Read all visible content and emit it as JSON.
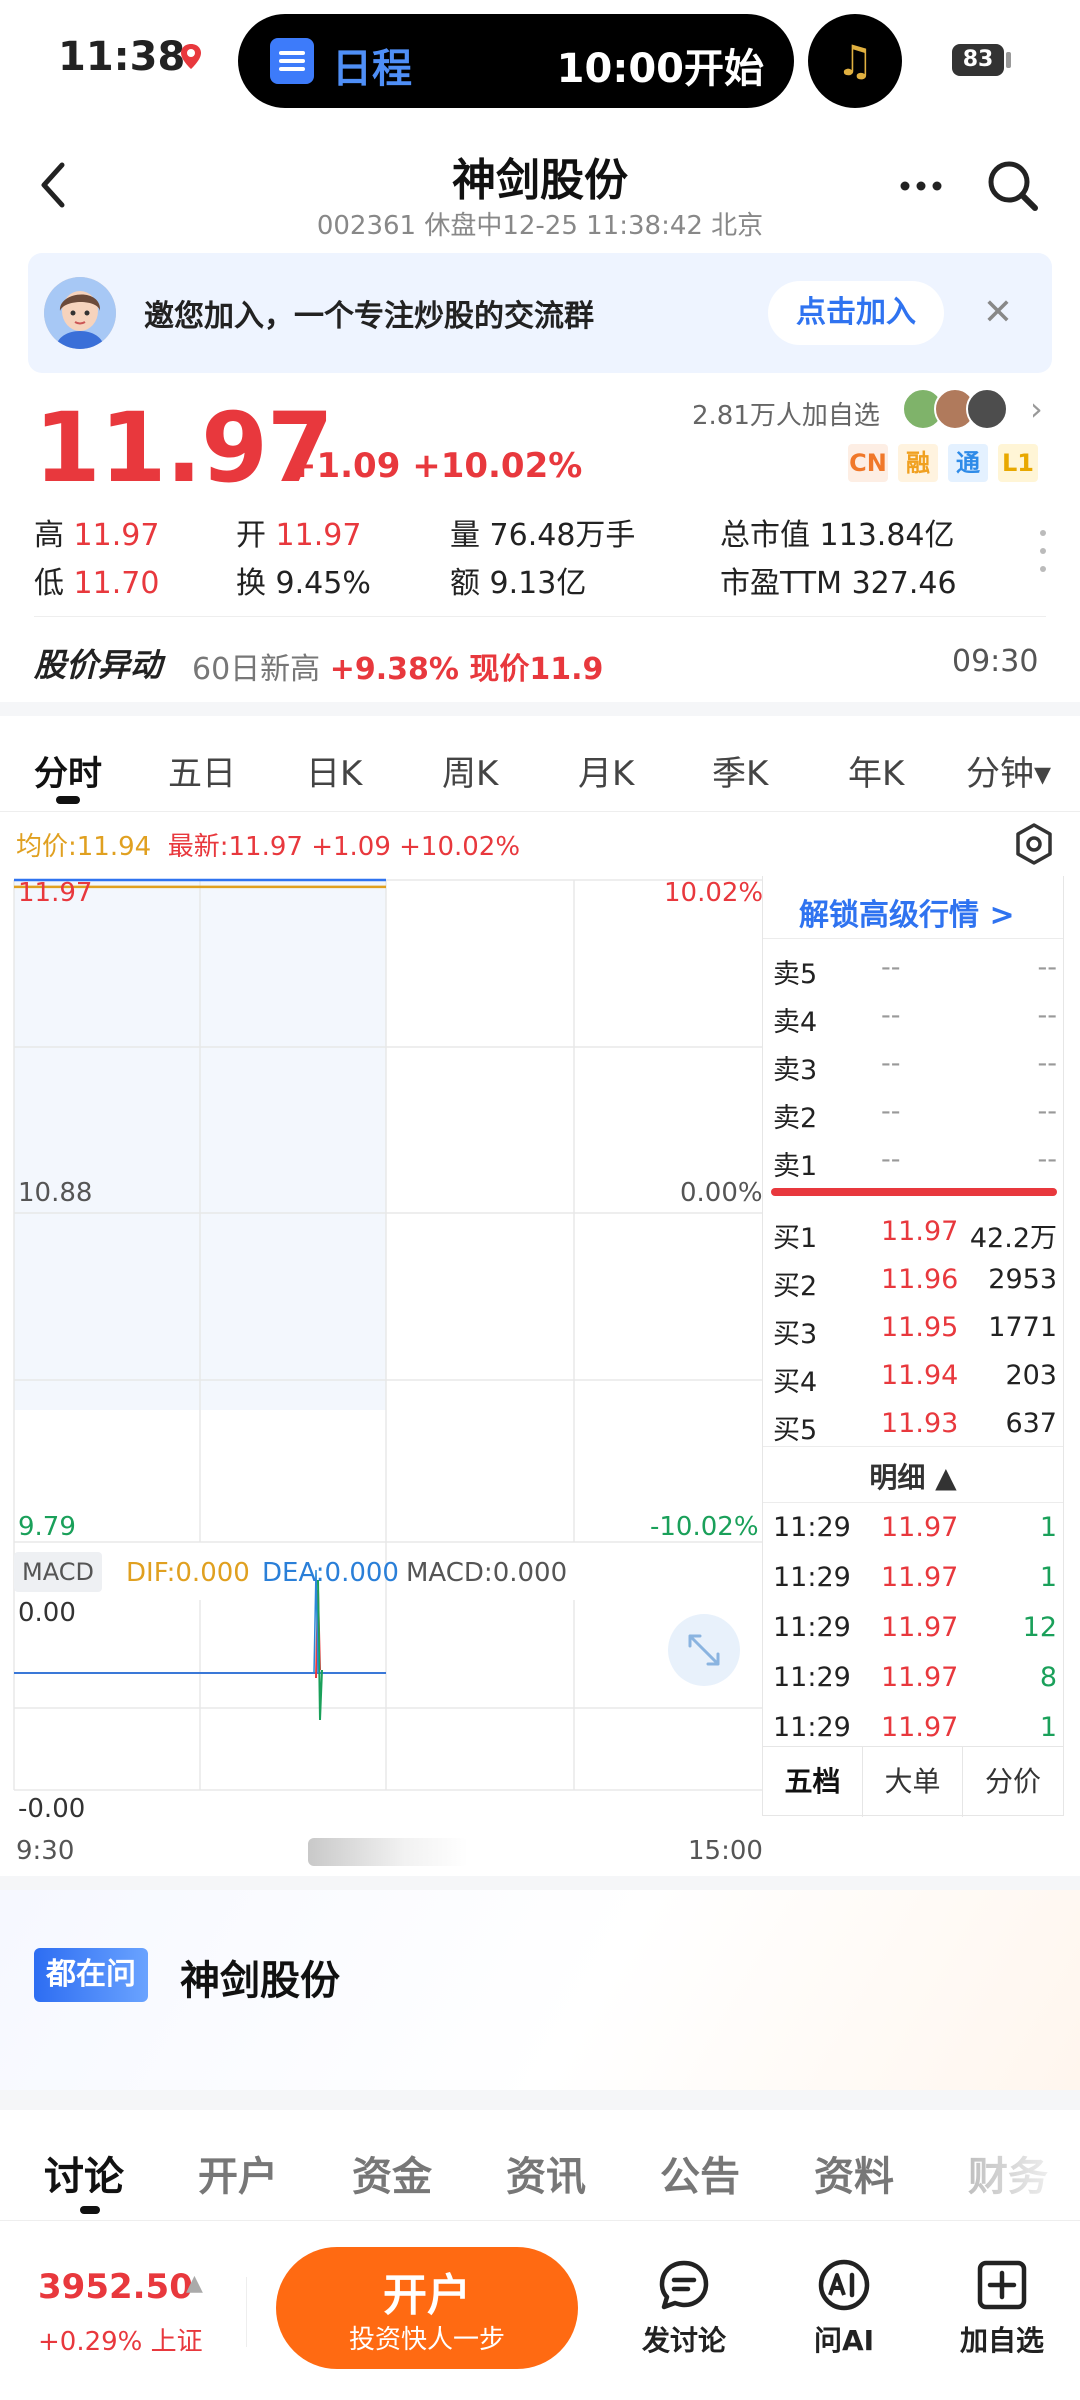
{
  "status": {
    "time": "11:38",
    "pill_title": "日程",
    "pill_time": "10:00开始",
    "battery": "83"
  },
  "header": {
    "title": "神剑股份",
    "subtitle": "002361 休盘中12-25 11:38:42 北京"
  },
  "banner": {
    "text": "邀您加入，一个专注炒股的交流群",
    "join": "点击加入",
    "close": "✕"
  },
  "quote": {
    "price": "11.97",
    "change": "+1.09 +10.02%",
    "followers": "2.81万人加自选",
    "tags": [
      "CN",
      "融",
      "通",
      "L1"
    ],
    "high_label": "高",
    "high": "11.97",
    "open_label": "开",
    "open": "11.97",
    "vol_label": "量",
    "vol": "76.48万手",
    "mcap_label": "总市值",
    "mcap": "113.84亿",
    "low_label": "低",
    "low": "11.70",
    "turn_label": "换",
    "turn": "9.45%",
    "amt_label": "额",
    "amt": "9.13亿",
    "pe_label": "市盈TTM",
    "pe": "327.46"
  },
  "alert": {
    "label": "股价异动",
    "text_a": "60日新高 ",
    "text_b": "+9.38% 现价11.9",
    "time": "09:30"
  },
  "tabs": [
    "分时",
    "五日",
    "日K",
    "周K",
    "月K",
    "季K",
    "年K",
    "分钟▾"
  ],
  "chart": {
    "legend_avg": "均价:11.94",
    "legend_latest": "最新:11.97 +1.09 +10.02%",
    "y_top": "11.97",
    "y_mid": "10.88",
    "y_bot": "9.79",
    "pct_top": "10.02%",
    "pct_mid": "0.00%",
    "pct_bot": "-10.02%",
    "macd_tag": "MACD",
    "dif": "DIF:0.000",
    "dea": "DEA:0.000",
    "macd": "MACD:0.000",
    "macd_top": "0.00",
    "macd_bot": "-0.00",
    "x_start": "9:30",
    "x_end": "15:00"
  },
  "chart_data": {
    "type": "line",
    "x": [
      "9:30",
      "11:29"
    ],
    "series": [
      {
        "name": "最新",
        "values": [
          11.97,
          11.97
        ]
      },
      {
        "name": "均价",
        "values": [
          11.94,
          11.94
        ]
      }
    ],
    "ylim": [
      9.79,
      11.97
    ]
  },
  "book": {
    "unlock": "解锁高级行情 >",
    "sells": [
      {
        "k": "卖5",
        "p": "--",
        "q": "--"
      },
      {
        "k": "卖4",
        "p": "--",
        "q": "--"
      },
      {
        "k": "卖3",
        "p": "--",
        "q": "--"
      },
      {
        "k": "卖2",
        "p": "--",
        "q": "--"
      },
      {
        "k": "卖1",
        "p": "--",
        "q": "--"
      }
    ],
    "buys": [
      {
        "k": "买1",
        "p": "11.97",
        "q": "42.2万"
      },
      {
        "k": "买2",
        "p": "11.96",
        "q": "2953"
      },
      {
        "k": "买3",
        "p": "11.95",
        "q": "1771"
      },
      {
        "k": "买4",
        "p": "11.94",
        "q": "203"
      },
      {
        "k": "买5",
        "p": "11.93",
        "q": "637"
      }
    ],
    "detail_title": "明细 ▲",
    "details": [
      {
        "t": "11:29",
        "p": "11.97",
        "q": "1"
      },
      {
        "t": "11:29",
        "p": "11.97",
        "q": "1"
      },
      {
        "t": "11:29",
        "p": "11.97",
        "q": "12"
      },
      {
        "t": "11:29",
        "p": "11.97",
        "q": "8"
      },
      {
        "t": "11:29",
        "p": "11.97",
        "q": "1"
      }
    ],
    "tabs": [
      "五档",
      "大单",
      "分价"
    ]
  },
  "ask": {
    "badge": "都在问",
    "name": "神剑股份"
  },
  "bottom_tabs": [
    "讨论",
    "开户",
    "资金",
    "资讯",
    "公告",
    "资料",
    "财务"
  ],
  "bottombar": {
    "index_value": "3952.50",
    "index_arrow": "▲",
    "index_change": "+0.29% 上证",
    "open_main": "开户",
    "open_sub": "投资快人一步",
    "discuss": "发讨论",
    "ask_ai": "问AI",
    "add_watch": "加自选"
  },
  "colors": {
    "up": "#e8383d",
    "down": "#1aa05a",
    "accent": "#2f73f0",
    "orange": "#ff6a12"
  }
}
